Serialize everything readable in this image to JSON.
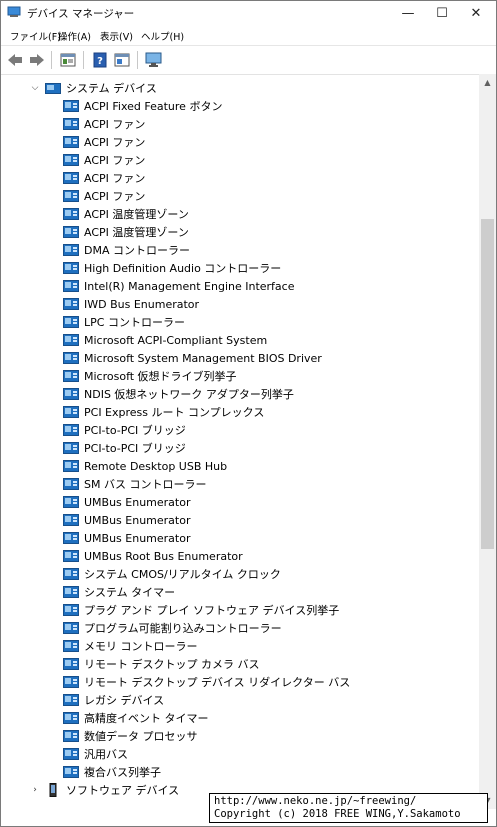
{
  "window": {
    "title": "デバイス マネージャー",
    "controls": {
      "minimize": "—",
      "maximize": "☐",
      "close": "✕"
    }
  },
  "menu": [
    "ファイル(F)",
    "操作(A)",
    "表示(V)",
    "ヘルプ(H)"
  ],
  "toolbar": [
    "back-icon",
    "forward-icon",
    "properties-icon",
    "help-icon",
    "driver-icon",
    "monitor-icon"
  ],
  "tree": {
    "category": "システム デバイス",
    "devices": [
      "ACPI Fixed Feature ボタン",
      "ACPI ファン",
      "ACPI ファン",
      "ACPI ファン",
      "ACPI ファン",
      "ACPI ファン",
      "ACPI 温度管理ゾーン",
      "ACPI 温度管理ゾーン",
      "DMA コントローラー",
      "High Definition Audio コントローラー",
      "Intel(R) Management Engine Interface",
      "IWD Bus Enumerator",
      "LPC コントローラー",
      "Microsoft ACPI-Compliant System",
      "Microsoft System Management BIOS Driver",
      "Microsoft 仮想ドライブ列挙子",
      "NDIS 仮想ネットワーク アダプター列挙子",
      "PCI Express ルート コンプレックス",
      "PCI-to-PCI ブリッジ",
      "PCI-to-PCI ブリッジ",
      "Remote Desktop USB Hub",
      "SM バス コントローラー",
      "UMBus Enumerator",
      "UMBus Enumerator",
      "UMBus Enumerator",
      "UMBus Root Bus Enumerator",
      "システム CMOS/リアルタイム クロック",
      "システム タイマー",
      "プラグ アンド プレイ ソフトウェア デバイス列挙子",
      "プログラム可能割り込みコントローラー",
      "メモリ コントローラー",
      "リモート デスクトップ カメラ バス",
      "リモート デスクトップ デバイス リダイレクター バス",
      "レガシ デバイス",
      "高精度イベント タイマー",
      "数値データ プロセッサ",
      "汎用バス",
      "複合バス列挙子"
    ],
    "next_category": "ソフトウェア デバイス"
  },
  "watermark": {
    "line1": "http://www.neko.ne.jp/~freewing/",
    "line2": "Copyright (c) 2018 FREE WING,Y.Sakamoto"
  },
  "colors": {
    "accent": "#0078d7",
    "device_icon": "#1e6fbf"
  }
}
